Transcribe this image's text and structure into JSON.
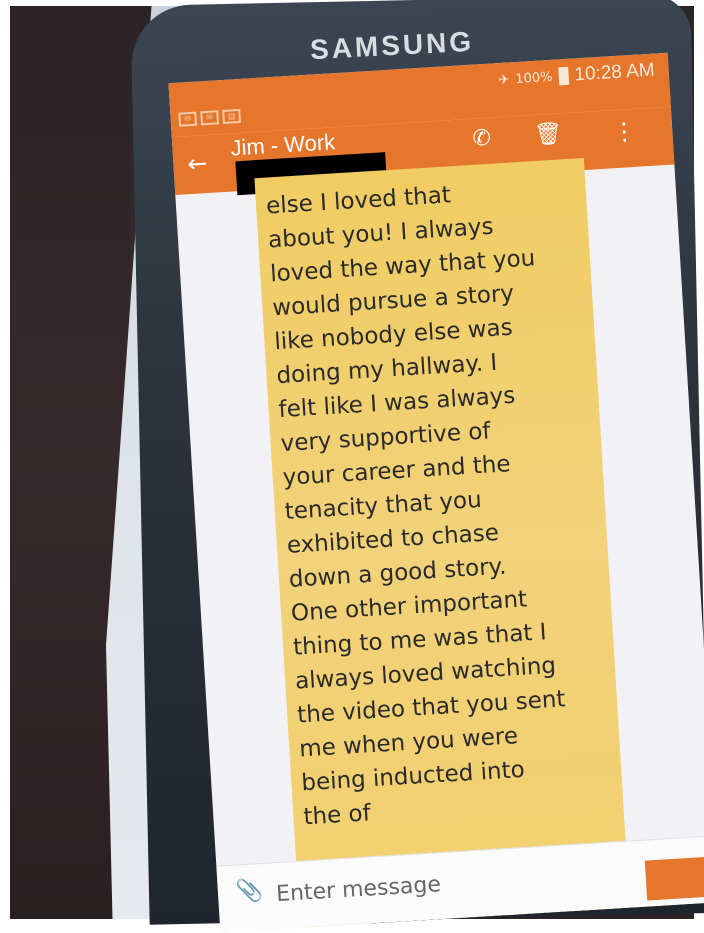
{
  "device": {
    "brand": "SAMSUNG"
  },
  "status_bar": {
    "mode_icon": "airplane-icon",
    "battery": "100%",
    "time": "10:28 AM"
  },
  "conversation": {
    "contact": "Jim - Work",
    "icons": {
      "back": "arrow-left-icon",
      "call": "phone-icon",
      "delete": "trash-icon",
      "more": "more-vert-icon"
    }
  },
  "message": {
    "text": "else   I loved that\nabout you!  I always\nloved the way that you\nwould pursue a story\nlike nobody else was\ndoing my hallway.  I\nfelt like I was always\nvery supportive of\nyour career and the\ntenacity that you\nexhibited to chase\ndown a good story.\nOne other important\nthing to me was that I\nalways loved watching\nthe video that you sent\nme when you were\nbeing inducted into\nthe                    of"
  },
  "composer": {
    "placeholder": "Enter message",
    "attach_icon": "paperclip-icon"
  },
  "colors": {
    "toolbar": "#e6762c",
    "bubble": "#f2d27a"
  }
}
